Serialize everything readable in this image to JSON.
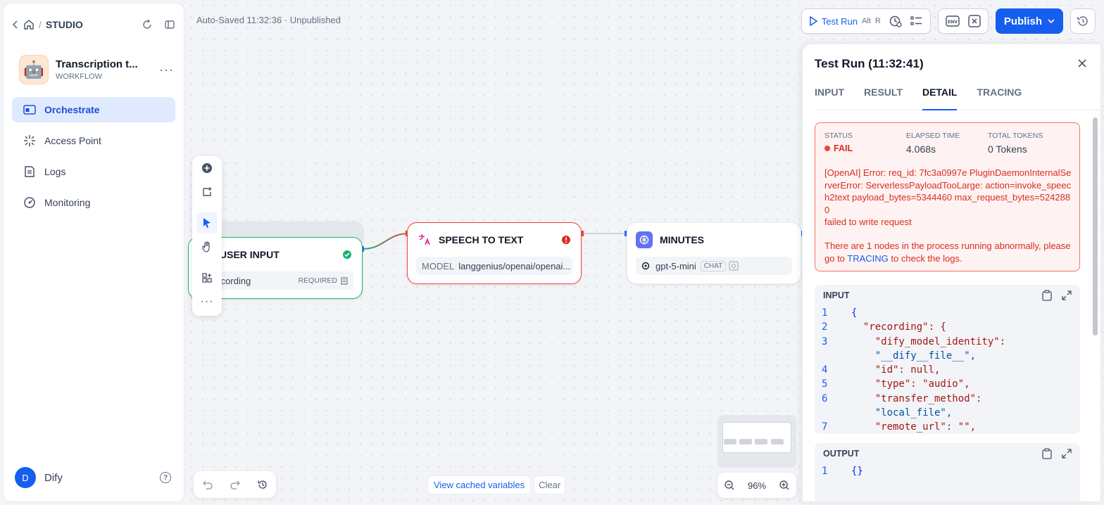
{
  "breadcrumb": {
    "studio": "STUDIO"
  },
  "app": {
    "name": "Transcription t...",
    "type": "WORKFLOW",
    "avatar": "🤖"
  },
  "nav": [
    {
      "label": "Orchestrate"
    },
    {
      "label": "Access Point"
    },
    {
      "label": "Logs"
    },
    {
      "label": "Monitoring"
    }
  ],
  "user": {
    "initial": "D",
    "name": "Dify"
  },
  "autosave": "Auto-Saved 11:32:36 · Unpublished",
  "toolbar": {
    "test_run": "Test Run",
    "kbd_alt": "Alt",
    "kbd_r": "R",
    "env": "ENV",
    "publish": "Publish"
  },
  "nodes": {
    "user_input": {
      "title": "USER INPUT",
      "var": "recording",
      "required": "REQUIRED"
    },
    "stt": {
      "title": "SPEECH TO TEXT",
      "model_label": "MODEL",
      "model": "langgenius/openai/openai..."
    },
    "minutes": {
      "title": "MINUTES",
      "model": "gpt-5-mini",
      "tag": "CHAT"
    }
  },
  "bottom": {
    "cached": "View cached variables",
    "clear": "Clear",
    "zoom": "96%"
  },
  "panel": {
    "title": "Test Run (11:32:41)",
    "tabs": [
      "INPUT",
      "RESULT",
      "DETAIL",
      "TRACING"
    ],
    "status_label": "STATUS",
    "status": "FAIL",
    "elapsed_label": "ELAPSED TIME",
    "elapsed": "4.068s",
    "tokens_label": "TOTAL TOKENS",
    "tokens": "0 Tokens",
    "error": "[OpenAI] Error: req_id: 7fc3a0997e PluginDaemonInternalServerError: ServerlessPayloadTooLarge: action=invoke_speech2text payload_bytes=5344460 max_request_bytes=5242880",
    "error_line2": "failed to write request",
    "notice_pre": "There are 1 nodes in the process running abnormally, please go to ",
    "notice_link": "TRACING",
    "notice_post": " to check the logs.",
    "input_label": "INPUT",
    "output_label": "OUTPUT",
    "input_code": [
      {
        "n": "1",
        "text": "{"
      },
      {
        "n": "2",
        "text": "  \"recording\": {"
      },
      {
        "n": "3",
        "text": "    \"dify_model_identity\":"
      },
      {
        "n": "",
        "text": "    \"__dify__file__\","
      },
      {
        "n": "4",
        "text": "    \"id\": null,"
      },
      {
        "n": "5",
        "text": "    \"type\": \"audio\","
      },
      {
        "n": "6",
        "text": "    \"transfer_method\":"
      },
      {
        "n": "",
        "text": "    \"local_file\","
      },
      {
        "n": "7",
        "text": "    \"remote_url\": \"\","
      }
    ],
    "output_code": [
      {
        "n": "1",
        "text": "{}"
      }
    ]
  }
}
